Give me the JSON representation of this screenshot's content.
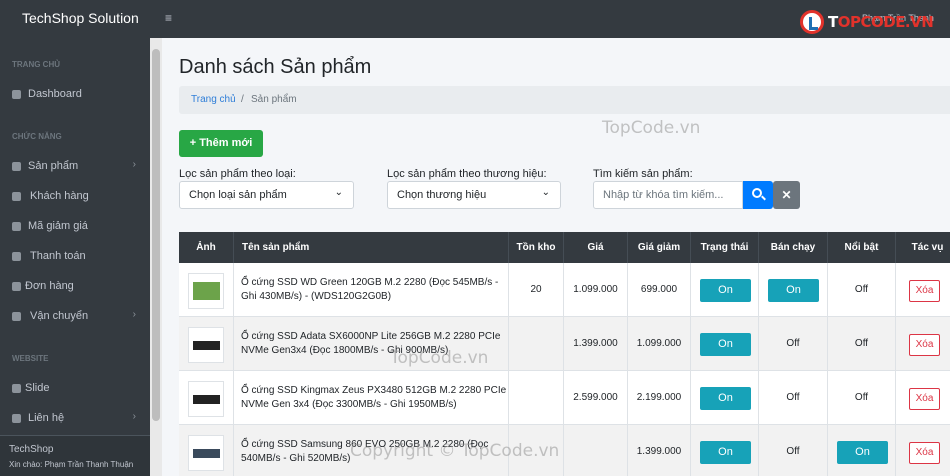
{
  "app": {
    "brand": "TechShop Solution",
    "menu_icon": "≡",
    "top_user": "Phạm Trần Thanh"
  },
  "logo": {
    "text_a": "T",
    "text_b": "OPCODE.VN"
  },
  "sidebar": {
    "sections": [
      {
        "header": "TRANG CHỦ"
      },
      {
        "header": "CHỨC NĂNG"
      },
      {
        "header": "WEBSITE"
      }
    ],
    "items": [
      {
        "label": "Dashboard",
        "icon": "dashboard-icon",
        "has_children": false
      },
      {
        "label": "Sản phẩm",
        "icon": "database-icon",
        "has_children": true
      },
      {
        "label": "Khách hàng",
        "icon": "users-icon",
        "has_children": false
      },
      {
        "label": "Mã giảm giá",
        "icon": "ticket-icon",
        "has_children": false
      },
      {
        "label": "Thanh toán",
        "icon": "money-icon",
        "has_children": false
      },
      {
        "label": "Đơn hàng",
        "icon": "file-icon",
        "has_children": false
      },
      {
        "label": "Vận chuyển",
        "icon": "truck-icon",
        "has_children": true
      },
      {
        "label": "Slide",
        "icon": "file-icon",
        "has_children": false
      },
      {
        "label": "Liên hệ",
        "icon": "phone-icon",
        "has_children": true
      }
    ],
    "chevron": "›",
    "footer": {
      "title": "TechShop",
      "greeting": "Xin chào: Phạm Trần Thanh Thuận"
    }
  },
  "page": {
    "title": "Danh sách Sản phẩm",
    "breadcrumb": {
      "home": "Trang chủ",
      "separator": "/",
      "current": "Sản phẩm"
    },
    "add_button": "+ Thêm mới"
  },
  "filters": {
    "category": {
      "label": "Lọc sản phẩm theo loại:",
      "value": "Chọn loại sản phẩm"
    },
    "brand": {
      "label": "Lọc sản phẩm theo thương hiệu:",
      "value": "Chọn thương hiệu"
    },
    "search": {
      "label": "Tìm kiếm sản phẩm:",
      "placeholder": "Nhập từ khóa tìm kiếm..."
    },
    "dropdown_icon": "⌄",
    "clear_icon": "✕"
  },
  "table": {
    "columns": [
      "Ảnh",
      "Tên sản phẩm",
      "Tồn kho",
      "Giá",
      "Giá giảm",
      "Trạng thái",
      "Bán chạy",
      "Nổi bật",
      "Tác vụ"
    ],
    "rows": [
      {
        "name": "Ổ cứng SSD WD Green 120GB M.2 2280 (Đọc 545MB/s - Ghi 430MB/s) - (WDS120G2G0B)",
        "stock": "20",
        "price": "1.099.000",
        "sale": "699.000",
        "status": "On",
        "bestseller": "On",
        "featured": "Off",
        "action": "Xóa"
      },
      {
        "name": "Ổ cứng SSD Adata SX6000NP Lite 256GB M.2 2280 PCIe NVMe Gen3x4 (Đọc 1800MB/s - Ghi 900MB/s)",
        "stock": "",
        "price": "1.399.000",
        "sale": "1.099.000",
        "status": "On",
        "bestseller": "Off",
        "featured": "Off",
        "action": "Xóa"
      },
      {
        "name": "Ổ cứng SSD Kingmax Zeus PX3480 512GB M.2 2280 PCIe NVMe Gen 3x4 (Đọc 3300MB/s - Ghi 1950MB/s)",
        "stock": "",
        "price": "2.599.000",
        "sale": "2.199.000",
        "status": "On",
        "bestseller": "Off",
        "featured": "Off",
        "action": "Xóa"
      },
      {
        "name": "Ổ cứng SSD Samsung 860 EVO 250GB M.2 2280 (Đọc 540MB/s - Ghi 520MB/s)",
        "stock": "",
        "price": "",
        "sale": "1.399.000",
        "status": "On",
        "bestseller": "Off",
        "featured": "On",
        "action": "Xóa"
      }
    ]
  },
  "watermarks": [
    "TopCode.vn",
    "TopCode.vn",
    "Copyright © TopCode.vn"
  ]
}
